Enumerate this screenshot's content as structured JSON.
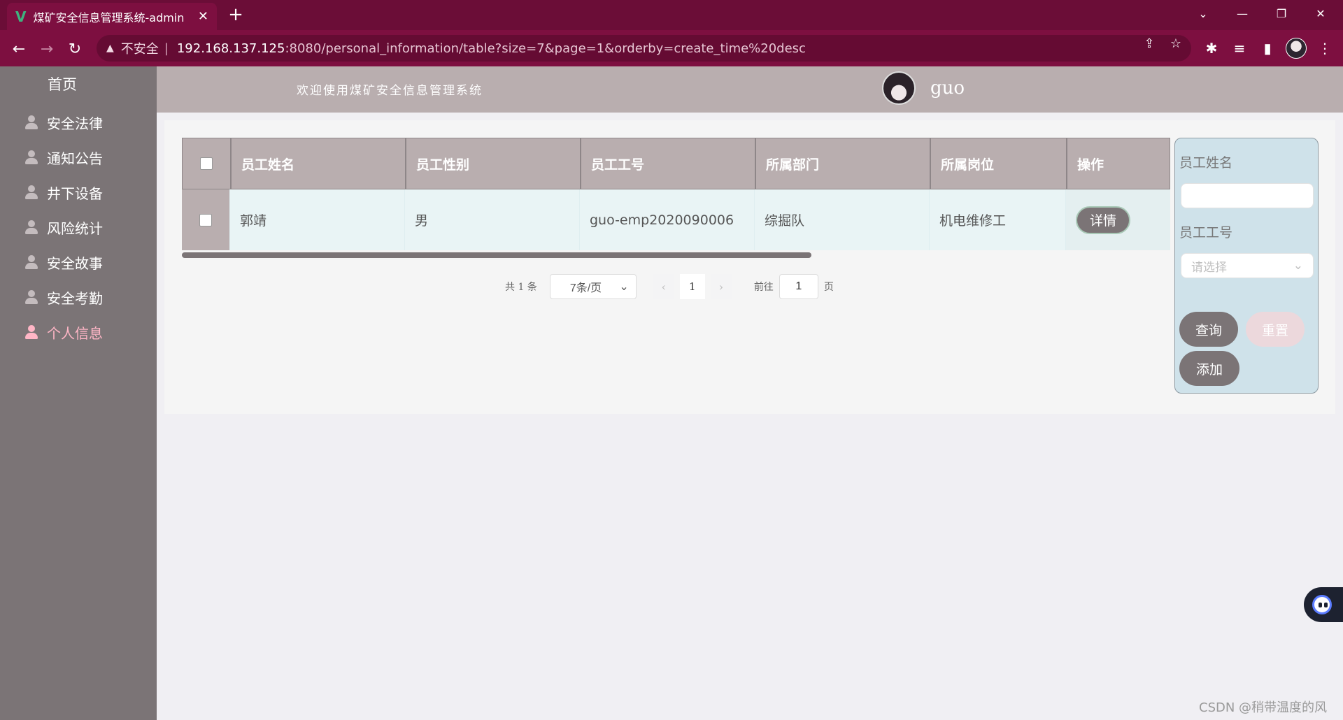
{
  "browser": {
    "tab_title": "煤矿安全信息管理系统-admin",
    "tab_close": "✕",
    "new_tab": "+",
    "insecure_label": "不安全",
    "url_host": "192.168.137.125",
    "url_rest": ":8080/personal_information/table?size=7&page=1&orderby=create_time%20desc"
  },
  "sidebar": {
    "home": "首页",
    "items": [
      {
        "label": "安全法律"
      },
      {
        "label": "通知公告"
      },
      {
        "label": "井下设备"
      },
      {
        "label": "风险统计"
      },
      {
        "label": "安全故事"
      },
      {
        "label": "安全考勤"
      },
      {
        "label": "个人信息"
      }
    ],
    "active_index": 6
  },
  "header": {
    "welcome": "欢迎使用煤矿安全信息管理系统",
    "username": "guo"
  },
  "table": {
    "columns": [
      "员工姓名",
      "员工性别",
      "员工工号",
      "所属部门",
      "所属岗位",
      "操作"
    ],
    "rows": [
      {
        "name": "郭靖",
        "gender": "男",
        "emp_id": "guo-emp2020090006",
        "department": "综掘队",
        "position": "机电维修工",
        "action": "详情"
      }
    ]
  },
  "pagination": {
    "total": "共 1 条",
    "page_size": "7条/页",
    "current_page": "1",
    "goto_label": "前往",
    "goto_value": "1",
    "page_suffix": "页"
  },
  "search": {
    "name_label": "员工姓名",
    "name_value": "",
    "id_label": "员工工号",
    "id_placeholder": "请选择",
    "query_button": "查询",
    "reset_button": "重置",
    "add_button": "添加"
  },
  "watermark": "CSDN @稍带温度的风",
  "colors": {
    "chrome": "#7d0f40",
    "sidebar": "#7b7476",
    "active_menu": "#ffb6c6",
    "header": "#b9aeaf",
    "search_panel": "#cfe2ea"
  }
}
